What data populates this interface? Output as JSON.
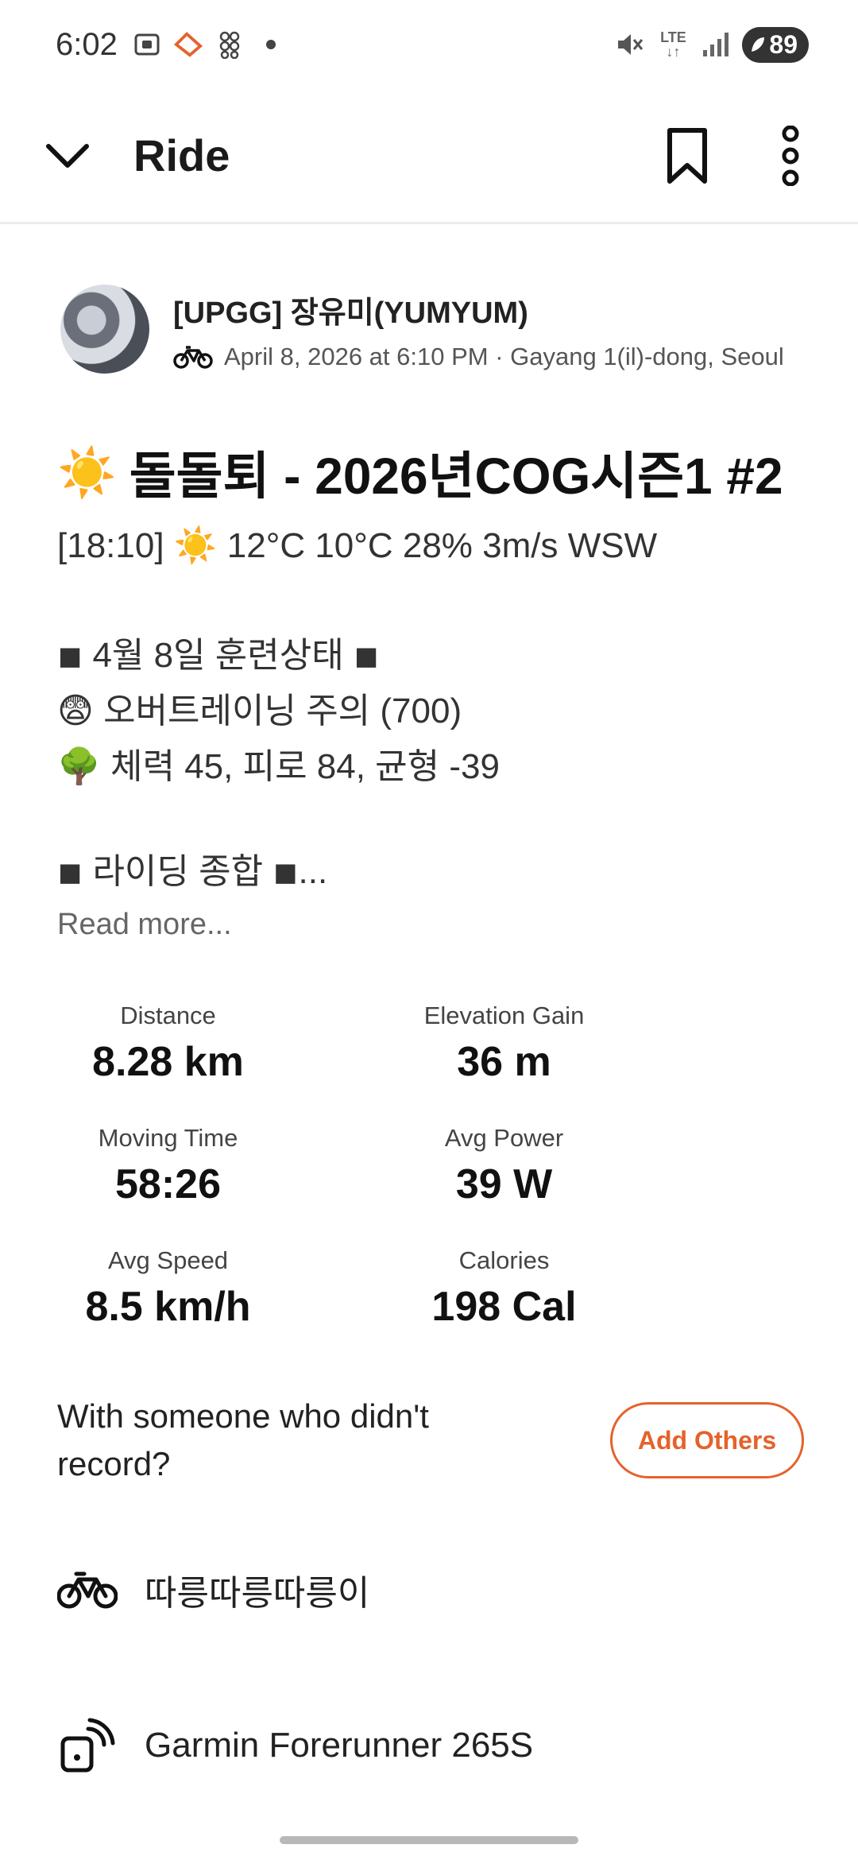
{
  "status_bar": {
    "time": "6:02",
    "battery": "89",
    "network": "LTE"
  },
  "header": {
    "title": "Ride"
  },
  "author": {
    "name": "[UPGG] 장유미(YUMYUM)",
    "meta": "April 8, 2026 at 6:10 PM · Gayang 1(il)-dong, Seoul"
  },
  "activity": {
    "title_emoji": "☀️",
    "title": "돌돌퇴 - 2026년COG시즌1 #2",
    "weather_line": "[18:10] ☀️ 12°C 10°C 28% 3m/s  WSW",
    "desc_line1": "◾ 4월 8일 훈련상태 ◾",
    "desc_line2": "😨 오버트레이닝 주의 (700)",
    "desc_line3": "🌳 체력 45, 피로 84, 균형 -39",
    "desc_line4": "◾ 라이딩 종합 ◾...",
    "read_more": "Read more..."
  },
  "stats": {
    "distance_label": "Distance",
    "distance_value": "8.28 km",
    "elevation_label": "Elevation Gain",
    "elevation_value": "36 m",
    "moving_time_label": "Moving Time",
    "moving_time_value": "58:26",
    "avg_power_label": "Avg Power",
    "avg_power_value": "39 W",
    "avg_speed_label": "Avg Speed",
    "avg_speed_value": "8.5 km/h",
    "calories_label": "Calories",
    "calories_value": "198 Cal"
  },
  "add_others": {
    "question": "With someone who didn't record?",
    "button_label": "Add Others"
  },
  "gear": {
    "bike_name": "따릉따릉따릉이",
    "device_name": "Garmin Forerunner 265S"
  },
  "colors": {
    "accent": "#e5622b",
    "text": "#1a1a1a",
    "muted": "#666666"
  }
}
